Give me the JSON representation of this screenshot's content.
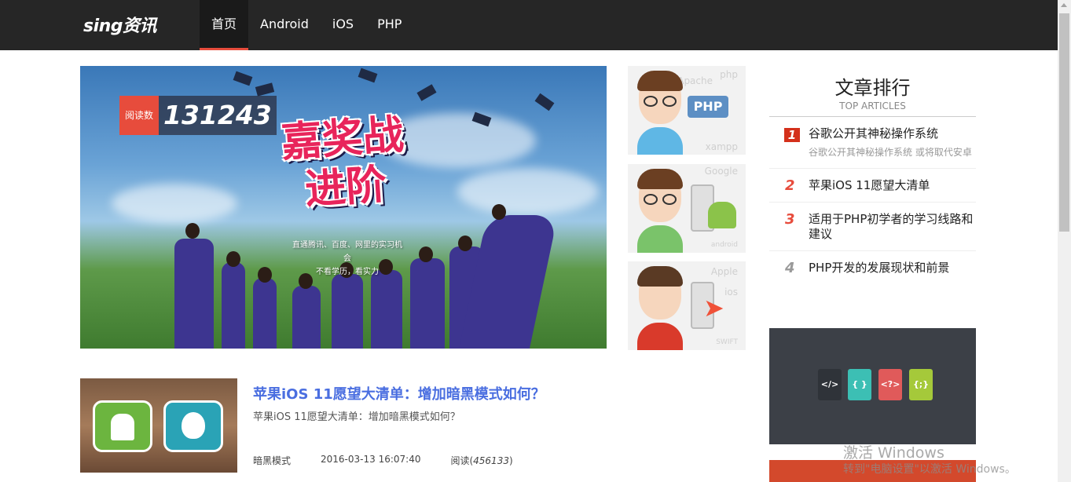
{
  "header": {
    "logo": "sing资讯",
    "nav": [
      "首页",
      "Android",
      "iOS",
      "PHP"
    ],
    "active_index": 0
  },
  "banner": {
    "read_label": "阅读数",
    "read_count": "131243",
    "title": "嘉奖战进阶",
    "subtitle_line1": "直通腾讯、百度、网里的实习机会",
    "subtitle_line2": "不看学历，看实力"
  },
  "avatar_cards": [
    {
      "tags": [
        "Apache",
        "php",
        "xampp"
      ],
      "logo": "PHP",
      "shirt_color": "#5fb7e5"
    },
    {
      "tags": [
        "Google",
        "android"
      ],
      "logo": "android-icon",
      "shirt_color": "#7ac36a"
    },
    {
      "tags": [
        "Apple",
        "ios",
        "SWIFT"
      ],
      "logo": "swift-icon",
      "shirt_color": "#d93a2b"
    }
  ],
  "article": {
    "title": "苹果iOS 11愿望大清单：增加暗黑模式如何？",
    "desc": "苹果iOS 11愿望大清单：增加暗黑模式如何？",
    "tag": "暗黑模式",
    "date": "2016-03-13 16:07:40",
    "views_label": "阅读(",
    "views": "456133",
    "views_close": ")"
  },
  "sidebar": {
    "title": "文章排行",
    "subtitle": "TOP ARTICLES",
    "items": [
      {
        "num": "1",
        "text": "谷歌公开其神秘操作系统",
        "desc": "谷歌公开其神秘操作系统 或将取代安卓",
        "color": "#d4301b"
      },
      {
        "num": "2",
        "text": "苹果iOS 11愿望大清单",
        "color": "#e74c3c"
      },
      {
        "num": "3",
        "text": "适用于PHP初学者的学习线路和建议",
        "color": "#e74c3c"
      },
      {
        "num": "4",
        "text": "PHP开发的发展现状和前景",
        "color": "#999999"
      }
    ]
  },
  "watermark": {
    "line1": "激活 Windows",
    "line2": "转到\"电脑设置\"以激活 Windows。"
  }
}
